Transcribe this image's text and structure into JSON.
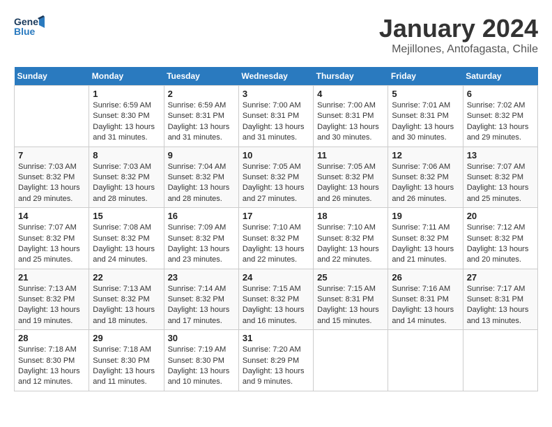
{
  "header": {
    "logo_line1": "General",
    "logo_line2": "Blue",
    "title": "January 2024",
    "subtitle": "Mejillones, Antofagasta, Chile"
  },
  "weekdays": [
    "Sunday",
    "Monday",
    "Tuesday",
    "Wednesday",
    "Thursday",
    "Friday",
    "Saturday"
  ],
  "weeks": [
    [
      {
        "day": "",
        "info": ""
      },
      {
        "day": "1",
        "info": "Sunrise: 6:59 AM\nSunset: 8:30 PM\nDaylight: 13 hours\nand 31 minutes."
      },
      {
        "day": "2",
        "info": "Sunrise: 6:59 AM\nSunset: 8:31 PM\nDaylight: 13 hours\nand 31 minutes."
      },
      {
        "day": "3",
        "info": "Sunrise: 7:00 AM\nSunset: 8:31 PM\nDaylight: 13 hours\nand 31 minutes."
      },
      {
        "day": "4",
        "info": "Sunrise: 7:00 AM\nSunset: 8:31 PM\nDaylight: 13 hours\nand 30 minutes."
      },
      {
        "day": "5",
        "info": "Sunrise: 7:01 AM\nSunset: 8:31 PM\nDaylight: 13 hours\nand 30 minutes."
      },
      {
        "day": "6",
        "info": "Sunrise: 7:02 AM\nSunset: 8:32 PM\nDaylight: 13 hours\nand 29 minutes."
      }
    ],
    [
      {
        "day": "7",
        "info": "Sunrise: 7:03 AM\nSunset: 8:32 PM\nDaylight: 13 hours\nand 29 minutes."
      },
      {
        "day": "8",
        "info": "Sunrise: 7:03 AM\nSunset: 8:32 PM\nDaylight: 13 hours\nand 28 minutes."
      },
      {
        "day": "9",
        "info": "Sunrise: 7:04 AM\nSunset: 8:32 PM\nDaylight: 13 hours\nand 28 minutes."
      },
      {
        "day": "10",
        "info": "Sunrise: 7:05 AM\nSunset: 8:32 PM\nDaylight: 13 hours\nand 27 minutes."
      },
      {
        "day": "11",
        "info": "Sunrise: 7:05 AM\nSunset: 8:32 PM\nDaylight: 13 hours\nand 26 minutes."
      },
      {
        "day": "12",
        "info": "Sunrise: 7:06 AM\nSunset: 8:32 PM\nDaylight: 13 hours\nand 26 minutes."
      },
      {
        "day": "13",
        "info": "Sunrise: 7:07 AM\nSunset: 8:32 PM\nDaylight: 13 hours\nand 25 minutes."
      }
    ],
    [
      {
        "day": "14",
        "info": "Sunrise: 7:07 AM\nSunset: 8:32 PM\nDaylight: 13 hours\nand 25 minutes."
      },
      {
        "day": "15",
        "info": "Sunrise: 7:08 AM\nSunset: 8:32 PM\nDaylight: 13 hours\nand 24 minutes."
      },
      {
        "day": "16",
        "info": "Sunrise: 7:09 AM\nSunset: 8:32 PM\nDaylight: 13 hours\nand 23 minutes."
      },
      {
        "day": "17",
        "info": "Sunrise: 7:10 AM\nSunset: 8:32 PM\nDaylight: 13 hours\nand 22 minutes."
      },
      {
        "day": "18",
        "info": "Sunrise: 7:10 AM\nSunset: 8:32 PM\nDaylight: 13 hours\nand 22 minutes."
      },
      {
        "day": "19",
        "info": "Sunrise: 7:11 AM\nSunset: 8:32 PM\nDaylight: 13 hours\nand 21 minutes."
      },
      {
        "day": "20",
        "info": "Sunrise: 7:12 AM\nSunset: 8:32 PM\nDaylight: 13 hours\nand 20 minutes."
      }
    ],
    [
      {
        "day": "21",
        "info": "Sunrise: 7:13 AM\nSunset: 8:32 PM\nDaylight: 13 hours\nand 19 minutes."
      },
      {
        "day": "22",
        "info": "Sunrise: 7:13 AM\nSunset: 8:32 PM\nDaylight: 13 hours\nand 18 minutes."
      },
      {
        "day": "23",
        "info": "Sunrise: 7:14 AM\nSunset: 8:32 PM\nDaylight: 13 hours\nand 17 minutes."
      },
      {
        "day": "24",
        "info": "Sunrise: 7:15 AM\nSunset: 8:32 PM\nDaylight: 13 hours\nand 16 minutes."
      },
      {
        "day": "25",
        "info": "Sunrise: 7:15 AM\nSunset: 8:31 PM\nDaylight: 13 hours\nand 15 minutes."
      },
      {
        "day": "26",
        "info": "Sunrise: 7:16 AM\nSunset: 8:31 PM\nDaylight: 13 hours\nand 14 minutes."
      },
      {
        "day": "27",
        "info": "Sunrise: 7:17 AM\nSunset: 8:31 PM\nDaylight: 13 hours\nand 13 minutes."
      }
    ],
    [
      {
        "day": "28",
        "info": "Sunrise: 7:18 AM\nSunset: 8:30 PM\nDaylight: 13 hours\nand 12 minutes."
      },
      {
        "day": "29",
        "info": "Sunrise: 7:18 AM\nSunset: 8:30 PM\nDaylight: 13 hours\nand 11 minutes."
      },
      {
        "day": "30",
        "info": "Sunrise: 7:19 AM\nSunset: 8:30 PM\nDaylight: 13 hours\nand 10 minutes."
      },
      {
        "day": "31",
        "info": "Sunrise: 7:20 AM\nSunset: 8:29 PM\nDaylight: 13 hours\nand 9 minutes."
      },
      {
        "day": "",
        "info": ""
      },
      {
        "day": "",
        "info": ""
      },
      {
        "day": "",
        "info": ""
      }
    ]
  ]
}
